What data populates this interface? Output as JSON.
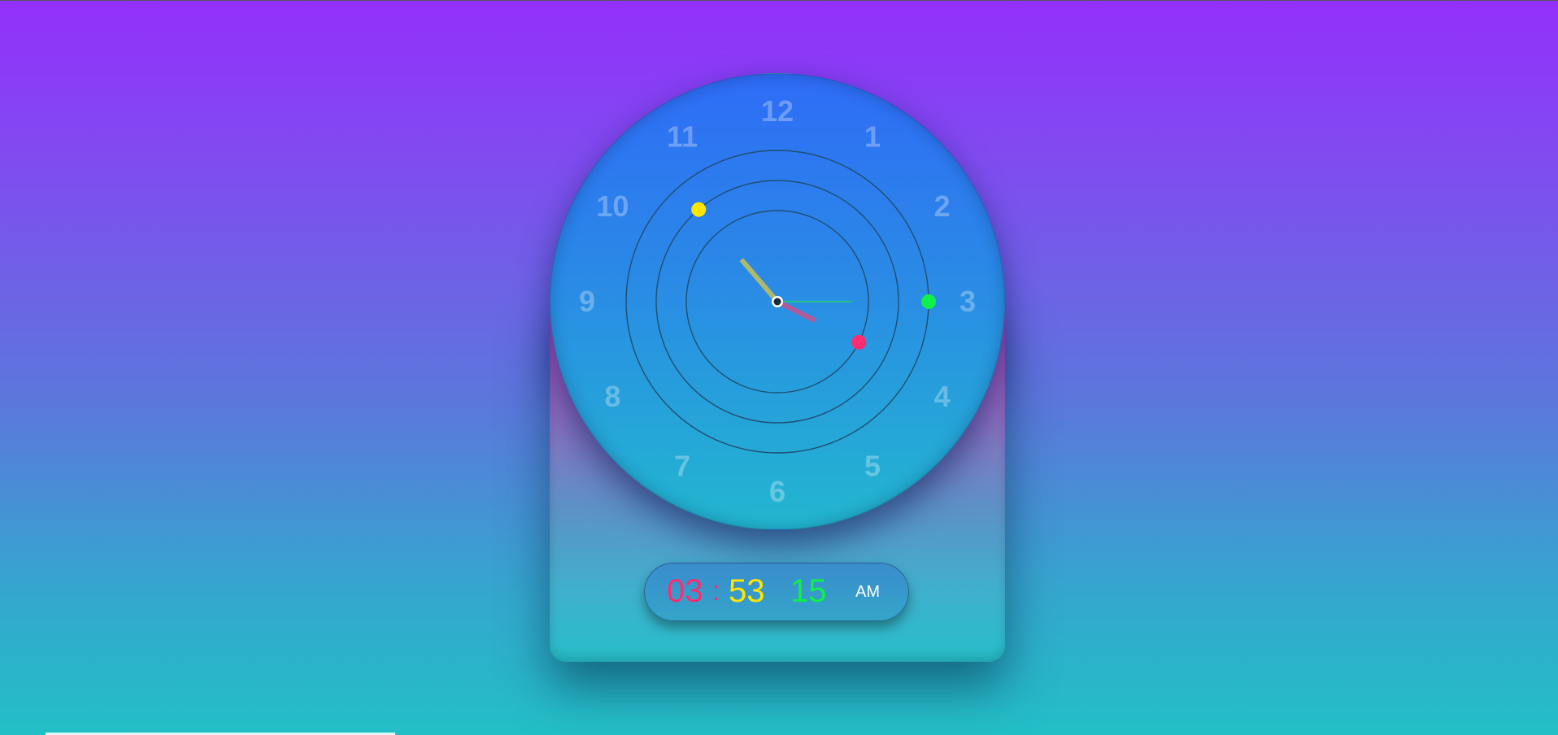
{
  "clock": {
    "numerals": [
      "12",
      "1",
      "2",
      "3",
      "4",
      "5",
      "6",
      "7",
      "8",
      "9",
      "10",
      "11"
    ],
    "time": {
      "hours": 3,
      "minutes": 53,
      "seconds": 15,
      "ampm": "AM"
    }
  },
  "digital_display": {
    "hours": "03",
    "separator": ":",
    "minutes": "53",
    "seconds": "15",
    "ampm": "AM"
  },
  "colors": {
    "hours": "#ff2d6f",
    "minutes": "#ffe600",
    "seconds": "#10f04a",
    "ampm": "#ffffff",
    "hour_hand": "#b35a9a",
    "minute_hand": "#b0b86c",
    "second_hand": "#21d36b"
  }
}
